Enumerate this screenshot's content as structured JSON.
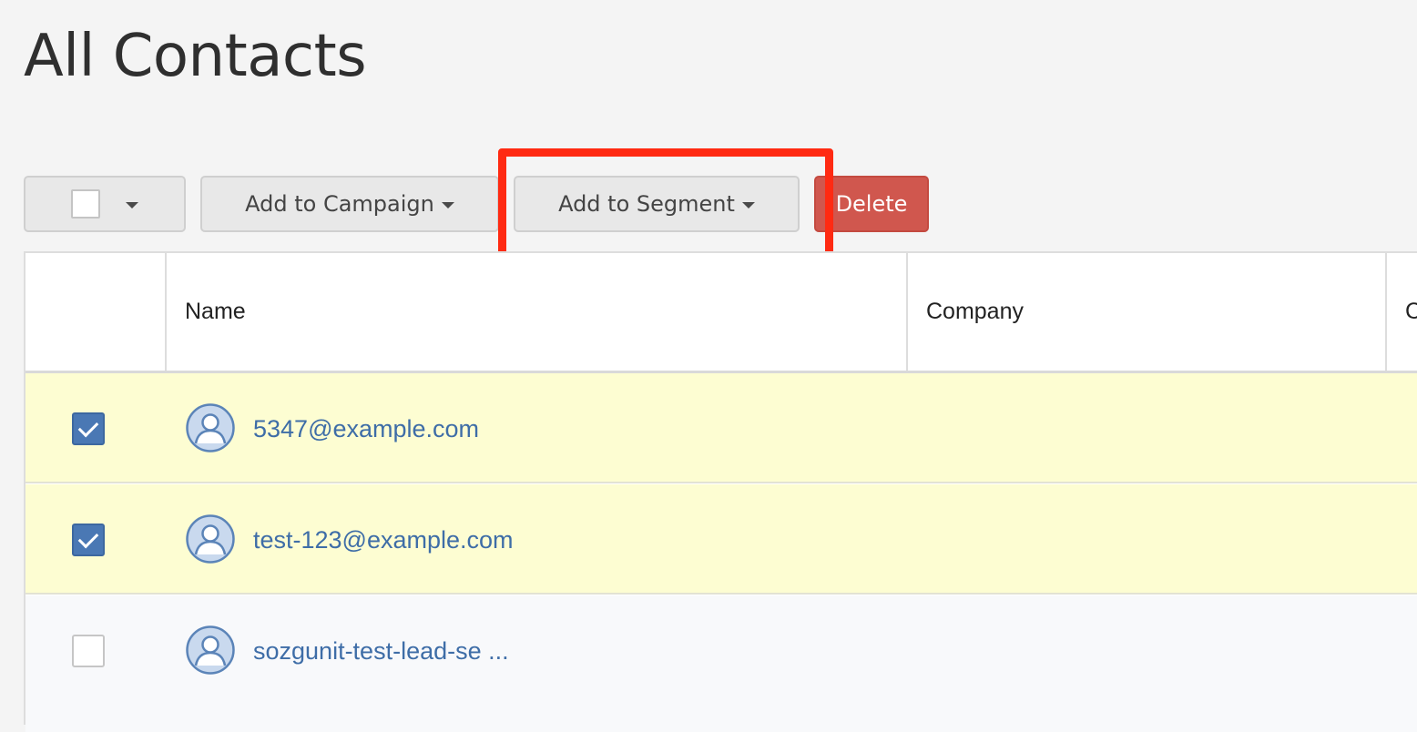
{
  "page": {
    "title": "All Contacts"
  },
  "toolbar": {
    "add_to_campaign_label": "Add to Campaign",
    "add_to_segment_label": "Add to Segment",
    "delete_label": "Delete"
  },
  "table": {
    "columns": [
      "",
      "Name",
      "Company",
      "C"
    ],
    "rows": [
      {
        "name": "5347@example.com",
        "company": "",
        "checked": true
      },
      {
        "name": "test-123@example.com",
        "company": "",
        "checked": true
      },
      {
        "name": "sozgunit-test-lead-se ...",
        "company": "",
        "checked": false
      }
    ]
  },
  "colors": {
    "accent_link": "#3e6da7",
    "checkbox_checked": "#4a78b4",
    "delete_button": "#d0574e",
    "selected_row": "#fdfdd2",
    "highlight_box": "#ff2a12"
  },
  "icons": [
    "caret-down-icon",
    "user-avatar-icon",
    "checkmark-icon"
  ]
}
